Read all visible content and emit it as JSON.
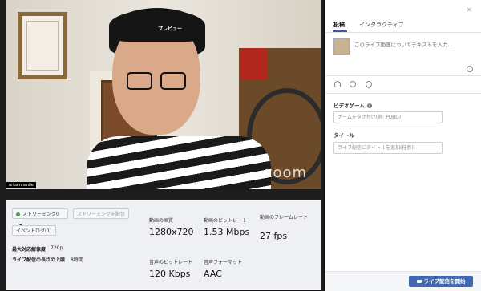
{
  "video": {
    "preview_label": "プレビュー",
    "name_tag": "urkam smile",
    "watermark": "zoom"
  },
  "stream_controls": {
    "streaming_select": "ストリーミング0",
    "streaming_preview_button": "ストリーミングを配信",
    "event_log_button": "イベントログ(1)",
    "status_color": "#3ea84a"
  },
  "limits": {
    "max_resolution_label": "最大対応解像度",
    "max_resolution_value": "720p",
    "max_duration_label": "ライブ配信の長さの上限",
    "max_duration_value": "8時間"
  },
  "metrics": [
    {
      "label": "動画の画質",
      "value": "1280x720"
    },
    {
      "label": "動画のビットレート",
      "value": "1.53 Mbps"
    },
    {
      "label": "動画のフレームレート",
      "value": "27 fps"
    },
    {
      "label": "音声のビットレート",
      "value": "120 Kbps"
    },
    {
      "label": "音声フォーマット",
      "value": "AAC"
    }
  ],
  "composer": {
    "tabs": [
      "投稿",
      "インタラクティブ"
    ],
    "post_placeholder": "このライブ動画についてテキストを入力...",
    "game_label": "ビデオゲーム",
    "game_placeholder": "ゲームをタグ付け(例: PUBG)",
    "title_label": "タイトル",
    "title_placeholder": "ライブ配信にタイトルを追加(任意)",
    "go_live_button": "ライブ配信を開始",
    "accent_color": "#4267b2"
  }
}
